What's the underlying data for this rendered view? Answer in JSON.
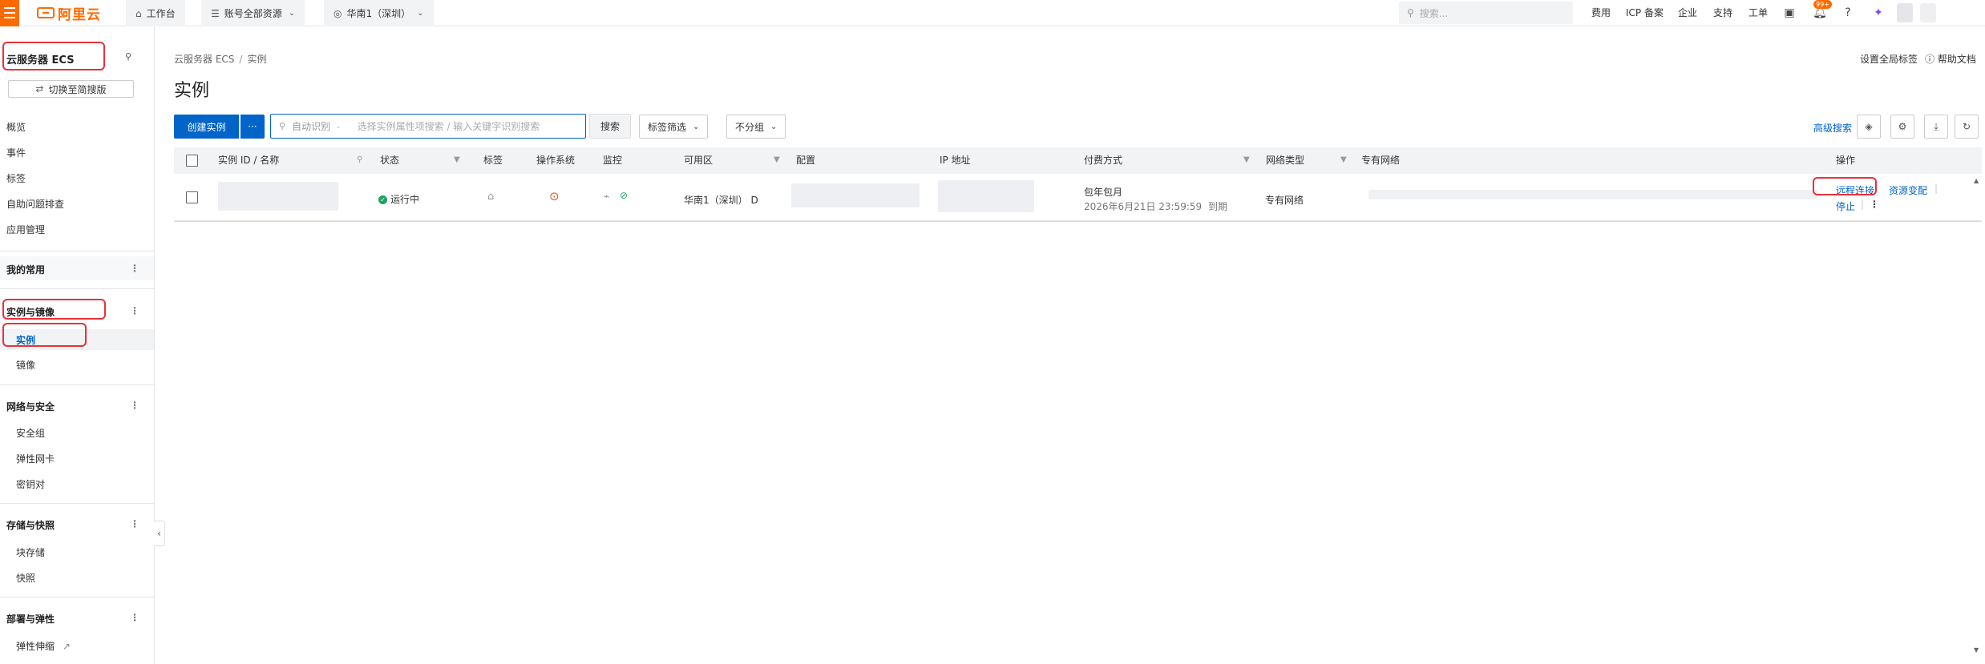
{
  "topbar": {
    "brand": "阿里云",
    "workbench": "工作台",
    "account_scope": "账号全部资源",
    "region": "华南1（深圳）",
    "search_placeholder": "搜索...",
    "links": [
      "费用",
      "ICP 备案",
      "企业",
      "支持",
      "工单"
    ],
    "notification_badge": "99+",
    "brand_color": "#ff6a00"
  },
  "sidebar": {
    "title": "云服务器 ECS",
    "switch_label": "切换至简搜版",
    "items_top": [
      "概览",
      "事件",
      "标签",
      "自助问题排查",
      "应用管理"
    ],
    "groups": [
      {
        "label": "我的常用",
        "items": []
      },
      {
        "label": "实例与镜像",
        "items": [
          "实例",
          "镜像"
        ]
      },
      {
        "label": "网络与安全",
        "items": [
          "安全组",
          "弹性网卡",
          "密钥对"
        ]
      },
      {
        "label": "存储与快照",
        "items": [
          "块存储",
          "快照"
        ]
      },
      {
        "label": "部署与弹性",
        "items": [
          "弹性伸缩"
        ]
      }
    ],
    "active_item": "实例"
  },
  "main": {
    "breadcrumb": [
      "云服务器 ECS",
      "实例"
    ],
    "title": "实例",
    "global_tag": "设置全局标签",
    "help_doc": "帮助文档",
    "create_button": "创建实例",
    "more_button": "···",
    "search_mode": "自动识别",
    "search_placeholder": "选择实例属性项搜索 / 输入关键字识别搜索",
    "search_button": "搜索",
    "tag_filter": "标签筛选",
    "group_select": "不分组",
    "advanced_search": "高级搜索"
  },
  "table": {
    "columns": [
      "实例 ID / 名称",
      "状态",
      "标签",
      "操作系统",
      "监控",
      "可用区",
      "配置",
      "IP 地址",
      "付费方式",
      "网络类型",
      "专有网络",
      "操作"
    ],
    "rows": [
      {
        "status": "运行中",
        "zone": "华南1（深圳） D",
        "pay_type": "包年包月",
        "expire": "2026年6月21日 23:59:59",
        "expire_suffix": "到期",
        "network_type": "专有网络",
        "actions": [
          "远程连接",
          "资源变配",
          "停止"
        ]
      }
    ]
  },
  "colors": {
    "primary": "#0064c8",
    "running": "#20a162",
    "highlight_border": "#e8313a"
  }
}
